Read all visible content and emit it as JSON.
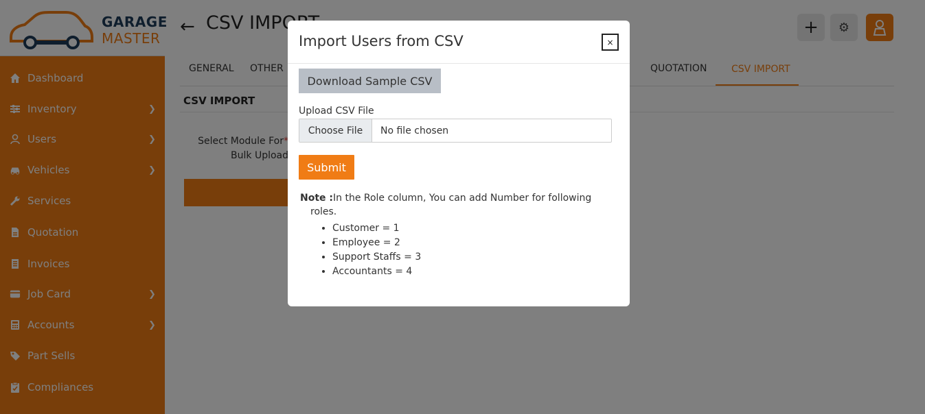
{
  "brand": {
    "line1": "GARAGE",
    "line2": "MASTER",
    "primary": "#f07c15",
    "dark": "#1f3d5a"
  },
  "sidebar": {
    "items": [
      {
        "label": "Dashboard",
        "icon": "home-icon",
        "has_children": false
      },
      {
        "label": "Inventory",
        "icon": "sliders-icon",
        "has_children": true
      },
      {
        "label": "Users",
        "icon": "user-icon",
        "has_children": true
      },
      {
        "label": "Vehicles",
        "icon": "car-icon",
        "has_children": true
      },
      {
        "label": "Services",
        "icon": "wrench-icon",
        "has_children": false
      },
      {
        "label": "Quotation",
        "icon": "file-icon",
        "has_children": false
      },
      {
        "label": "Invoices",
        "icon": "receipt-icon",
        "has_children": false
      },
      {
        "label": "Job Card",
        "icon": "card-icon",
        "has_children": true
      },
      {
        "label": "Accounts",
        "icon": "calculator-icon",
        "has_children": true
      },
      {
        "label": "Part Sells",
        "icon": "tag-icon",
        "has_children": false
      },
      {
        "label": "Compliances",
        "icon": "clipboard-icon",
        "has_children": false
      }
    ]
  },
  "header": {
    "title": "CSV IMPORT"
  },
  "tabs": [
    {
      "label": "GENERAL",
      "active": false
    },
    {
      "label": "OTHER",
      "active": false
    },
    {
      "label": "QUOTATION",
      "active": false
    },
    {
      "label": "CSV IMPORT",
      "active": true
    }
  ],
  "main": {
    "section_title": "CSV IMPORT",
    "module_label": "Select Module For",
    "module_label_line2": "Bulk Upload",
    "required_mark": "*"
  },
  "modal": {
    "title": "Import Users from CSV",
    "close_label": "×",
    "download_button": "Download Sample CSV",
    "upload_label": "Upload CSV File",
    "choose_button": "Choose File",
    "file_status": "No file chosen",
    "submit_button": "Submit",
    "note_prefix": "Note :",
    "note_text": "In the Role column, You can add Number for following",
    "note_text_cont": "roles.",
    "roles": [
      "Customer = 1",
      "Employee = 2",
      "Support Staffs = 3",
      "Accountants = 4"
    ]
  }
}
